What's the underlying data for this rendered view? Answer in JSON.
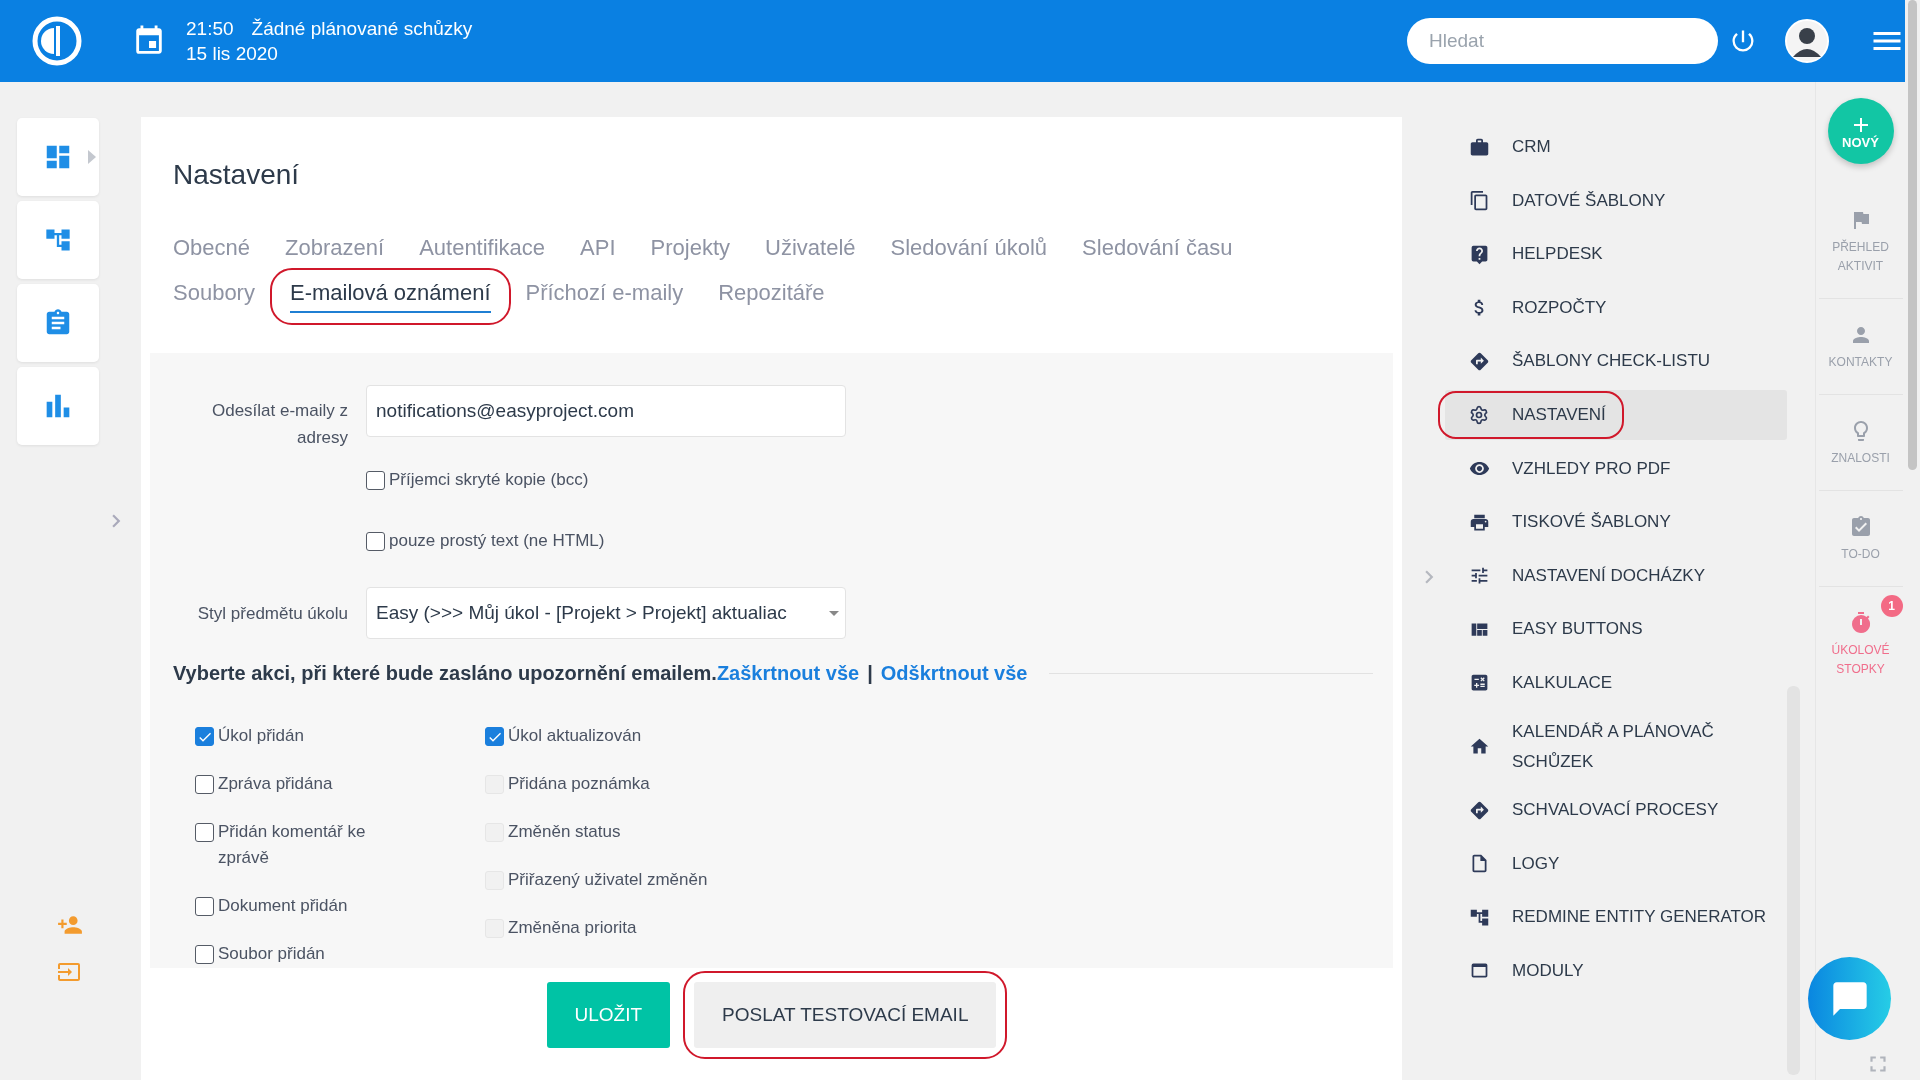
{
  "topbar": {
    "time": "21:50",
    "meeting_status": "Žádné plánované schůzky",
    "date": "15 lis 2020",
    "search": {
      "placeholder": "Hledat"
    }
  },
  "page": {
    "title": "Nastavení",
    "tabs": [
      {
        "label": "Obecné",
        "selected": false,
        "annotated": false
      },
      {
        "label": "Zobrazení",
        "selected": false,
        "annotated": false
      },
      {
        "label": "Autentifikace",
        "selected": false,
        "annotated": false
      },
      {
        "label": "API",
        "selected": false,
        "annotated": false
      },
      {
        "label": "Projekty",
        "selected": false,
        "annotated": false
      },
      {
        "label": "Uživatelé",
        "selected": false,
        "annotated": false
      },
      {
        "label": "Sledování úkolů",
        "selected": false,
        "annotated": false
      },
      {
        "label": "Sledování času",
        "selected": false,
        "annotated": false
      },
      {
        "label": "Soubory",
        "selected": false,
        "annotated": false
      },
      {
        "label": "E-mailová oznámení",
        "selected": true,
        "annotated": true
      },
      {
        "label": "Příchozí e-maily",
        "selected": false,
        "annotated": false
      },
      {
        "label": "Repozitáře",
        "selected": false,
        "annotated": false
      }
    ]
  },
  "form": {
    "sender": {
      "label": "Odesílat e-maily z adresy",
      "value": "notifications@easyproject.com"
    },
    "options": [
      {
        "label": "Příjemci skryté kopie (bcc)",
        "checked": false
      },
      {
        "label": "pouze prostý text (ne HTML)",
        "checked": false
      }
    ],
    "subject_style": {
      "label": "Styl předmětu úkolu",
      "value": "Easy (>>> Můj úkol - [Projekt > Projekt] aktualiac"
    }
  },
  "events": {
    "heading": "Vyberte akci, při které bude zasláno upozornění emailem.",
    "check_all": "Zaškrtnout vše",
    "separator": "|",
    "uncheck_all": "Odškrtnout vše",
    "columns": [
      {
        "items": [
          {
            "label": "Úkol přidán",
            "checked": true,
            "disabled": false
          },
          {
            "label": "Zpráva přidána",
            "checked": false,
            "disabled": false
          },
          {
            "label": "Přidán komentář ke zprávě",
            "checked": false,
            "disabled": false
          },
          {
            "label": "Dokument přidán",
            "checked": false,
            "disabled": false
          },
          {
            "label": "Soubor přidán",
            "checked": false,
            "disabled": false
          }
        ]
      },
      {
        "items": [
          {
            "label": "Úkol aktualizován",
            "checked": true,
            "disabled": false
          },
          {
            "label": "Přidána poznámka",
            "checked": false,
            "disabled": true
          },
          {
            "label": "Změněn status",
            "checked": false,
            "disabled": true
          },
          {
            "label": "Přiřazený uživatel změněn",
            "checked": false,
            "disabled": true
          },
          {
            "label": "Změněna priorita",
            "checked": false,
            "disabled": true
          }
        ]
      }
    ]
  },
  "buttons": [
    {
      "label": "ULOŽIT",
      "kind": "primary",
      "annotated": false
    },
    {
      "label": "POSLAT TESTOVACÍ EMAIL",
      "kind": "secondary",
      "annotated": true
    }
  ],
  "settings_menu": [
    {
      "label": "CRM",
      "selected": false,
      "annotated": false
    },
    {
      "label": "DATOVÉ ŠABLONY",
      "selected": false,
      "annotated": false
    },
    {
      "label": "HELPDESK",
      "selected": false,
      "annotated": false
    },
    {
      "label": "ROZPOČTY",
      "selected": false,
      "annotated": false
    },
    {
      "label": "ŠABLONY CHECK-LISTU",
      "selected": false,
      "annotated": false
    },
    {
      "label": "NASTAVENÍ",
      "selected": true,
      "annotated": true
    },
    {
      "label": "VZHLEDY PRO PDF",
      "selected": false,
      "annotated": false
    },
    {
      "label": "TISKOVÉ ŠABLONY",
      "selected": false,
      "annotated": false
    },
    {
      "label": "NASTAVENÍ DOCHÁZKY",
      "selected": false,
      "annotated": false
    },
    {
      "label": "EASY BUTTONS",
      "selected": false,
      "annotated": false
    },
    {
      "label": "KALKULACE",
      "selected": false,
      "annotated": false
    },
    {
      "label": "KALENDÁŘ A PLÁNOVAČ SCHŮZEK",
      "selected": false,
      "annotated": false
    },
    {
      "label": "SCHVALOVACÍ PROCESY",
      "selected": false,
      "annotated": false
    },
    {
      "label": "LOGY",
      "selected": false,
      "annotated": false
    },
    {
      "label": "REDMINE ENTITY GENERATOR",
      "selected": false,
      "annotated": false
    },
    {
      "label": "MODULY",
      "selected": false,
      "annotated": false
    }
  ],
  "quick_rail": {
    "new_button": "NOVÝ",
    "items": [
      {
        "label": "PŘEHLED AKTIVIT",
        "color": "#9aa0ab"
      },
      {
        "label": "KONTAKTY",
        "color": "#9aa0ab"
      },
      {
        "label": "ZNALOSTI",
        "color": "#9aa0ab"
      },
      {
        "label": "TO-DO",
        "color": "#9aa0ab"
      },
      {
        "label": "ÚKOLOVÉ STOPKY",
        "color": "#f06e8c",
        "badge": "1"
      }
    ]
  }
}
